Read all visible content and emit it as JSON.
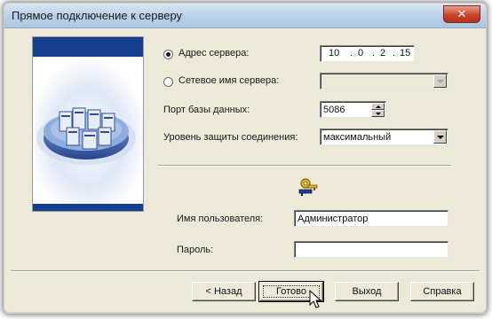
{
  "window": {
    "title": "Прямое подключение к серверу",
    "close_glyph": "✕"
  },
  "banner": {
    "icon": "database-servers-illustration",
    "colors": {
      "bar": "#153e8c"
    }
  },
  "form": {
    "server_address": {
      "label": "Адрес сервера:",
      "selected": true,
      "ip_octets": [
        "10",
        "0",
        "2",
        "15"
      ],
      "ip_dots": [
        ".",
        ".",
        "."
      ]
    },
    "server_name": {
      "label": "Сетевое имя сервера:",
      "selected": false,
      "value": ""
    },
    "db_port": {
      "label": "Порт базы данных:",
      "value": "5086"
    },
    "security_level": {
      "label": "Уровень защиты соединения:",
      "value": "максимальный"
    },
    "keys_icon": "keys-icon",
    "username": {
      "label": "Имя пользователя:",
      "value": "Администратор"
    },
    "password": {
      "label": "Пароль:",
      "value": ""
    }
  },
  "buttons": {
    "back": "< Назад",
    "finish": "Готово",
    "exit": "Выход",
    "help": "Справка"
  }
}
